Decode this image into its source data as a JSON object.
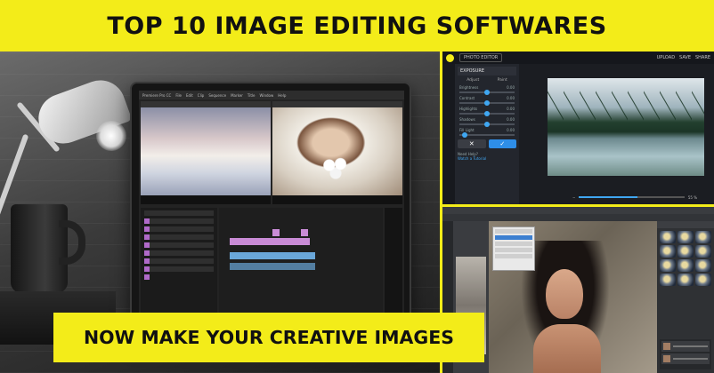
{
  "headline": "TOP 10 IMAGE EDITING SOFTWARES",
  "tagline": "NOW MAKE YOUR CREATIVE IMAGES",
  "colors": {
    "banner": "#f3ec19",
    "text": "#111111",
    "editor_accent": "#2e8ee8"
  },
  "video_editor": {
    "menu": [
      "Premiere Pro CC",
      "File",
      "Edit",
      "Clip",
      "Sequence",
      "Marker",
      "Title",
      "Window",
      "Help"
    ]
  },
  "photo_editor": {
    "app_label": "PHOTO EDITOR",
    "actions": [
      "UPLOAD",
      "SAVE",
      "SHARE"
    ],
    "panel_title": "EXPOSURE",
    "tabs": [
      "Adjust",
      "Paint"
    ],
    "sliders": [
      {
        "label": "Brightness",
        "value": "0.00",
        "level": 0.5
      },
      {
        "label": "Contrast",
        "value": "0.00",
        "level": 0.5
      },
      {
        "label": "Highlights",
        "value": "0.00",
        "level": 0.5
      },
      {
        "label": "Shadows",
        "value": "0.00",
        "level": 0.5
      },
      {
        "label": "Fill Light",
        "value": "0.00",
        "level": 0.1
      }
    ],
    "cancel_icon": "close-icon",
    "confirm_icon": "check-icon",
    "help_title": "Need Help?",
    "help_link": "Watch a Tutorial",
    "zoom": "55 %",
    "zoom_level": 0.55
  }
}
